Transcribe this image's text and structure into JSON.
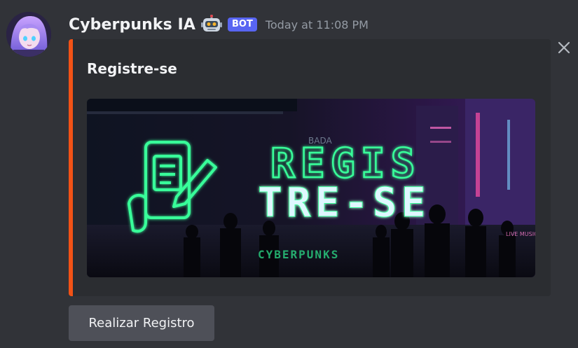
{
  "message": {
    "author": "Cyberpunks IA",
    "author_emoji": "robot-emoji",
    "badge": "BOT",
    "timestamp": "Today at 11:08 PM"
  },
  "embed": {
    "accent_color": "#f25216",
    "title": "Registre-se",
    "image": {
      "line1": "REGIS",
      "line2": "TRE-SE",
      "watermark": "CYBERPUNKS",
      "sign_small": "BADA",
      "sign_right": "LIVE MUSIC"
    }
  },
  "buttons": {
    "register_label": "Realizar Registro"
  },
  "colors": {
    "background": "#313338",
    "embed_background": "#2b2d31",
    "bot_badge": "#5865f2",
    "neon_green": "#39ff9a",
    "button": "#4e5058"
  }
}
